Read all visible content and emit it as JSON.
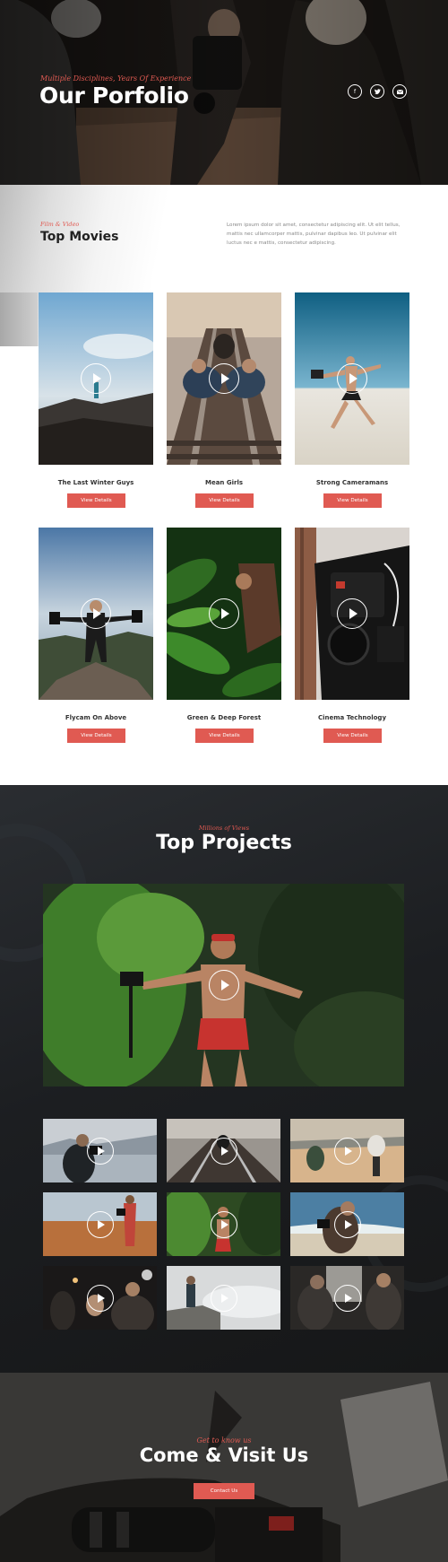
{
  "hero": {
    "eyebrow": "Multiple Disciplines, Years Of Experience",
    "title": "Our Porfolio",
    "social_icons": [
      "facebook-icon",
      "twitter-icon",
      "email-icon"
    ]
  },
  "movies": {
    "eyebrow": "Film & Video",
    "title": "Top Movies",
    "description": "Lorem ipsum dolor sit amet, consectetur adipiscing elit. Ut elit tellus, mattis nec ullamcorper mattis, pulvinar dapibus leo. Ut pulvinar elit luctus nec e mattis, consectetur adipiscing.",
    "cards": [
      {
        "title": "The Last Winter Guys",
        "button": "View Details"
      },
      {
        "title": "Mean Girls",
        "button": "View Details"
      },
      {
        "title": "Strong Cameramans",
        "button": "View Details"
      },
      {
        "title": "Flycam On Above",
        "button": "View Details"
      },
      {
        "title": "Green & Deep Forest",
        "button": "View Details"
      },
      {
        "title": "Cinema Technology",
        "button": "View Details"
      }
    ]
  },
  "projects": {
    "eyebrow": "Millions of Views",
    "title": "Top Projects"
  },
  "visit": {
    "eyebrow": "Get to know us",
    "title": "Come & Visit Us",
    "button": "Contact Us"
  },
  "colors": {
    "accent": "#e05a52",
    "dark_bg": "#1c1e21",
    "text_dark": "#222222"
  }
}
